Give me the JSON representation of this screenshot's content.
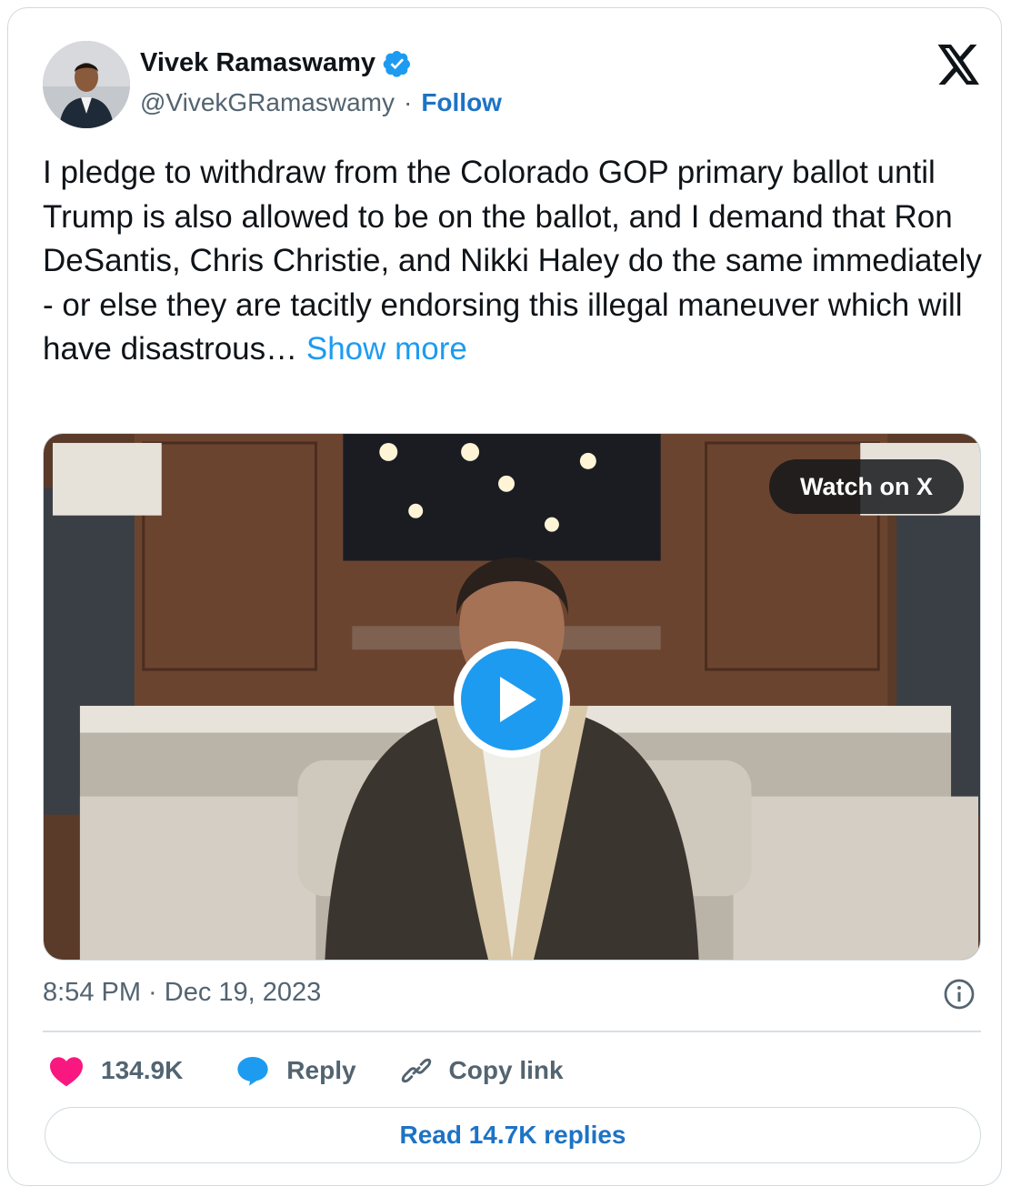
{
  "author": {
    "display_name": "Vivek Ramaswamy",
    "handle": "@VivekGRamaswamy",
    "separator": "·",
    "follow_label": "Follow",
    "verified": true,
    "avatar_icon": "profile-photo"
  },
  "brand": {
    "logo_icon": "x-logo"
  },
  "tweet": {
    "text": "I pledge to withdraw from the Colorado GOP primary ballot until Trump is also allowed to be on the ballot, and I demand that Ron DeSantis, Chris Christie, and Nikki Haley do the same immediately - or else they are tacitly endorsing this illegal maneuver which will have disastrous…",
    "show_more_label": "Show more",
    "timestamp": "8:54 PM · Dec 19, 2023"
  },
  "media": {
    "type": "video",
    "watch_label": "Watch on X",
    "play_icon": "play-icon"
  },
  "actions": {
    "likes": "134.9K",
    "reply_label": "Reply",
    "copy_link_label": "Copy link"
  },
  "replies_button": {
    "label": "Read 14.7K replies"
  },
  "colors": {
    "link": "#1d9bf0",
    "follow": "#1d73c5",
    "like": "#f91880",
    "secondary_text": "#536471",
    "border": "#cfd9de"
  }
}
